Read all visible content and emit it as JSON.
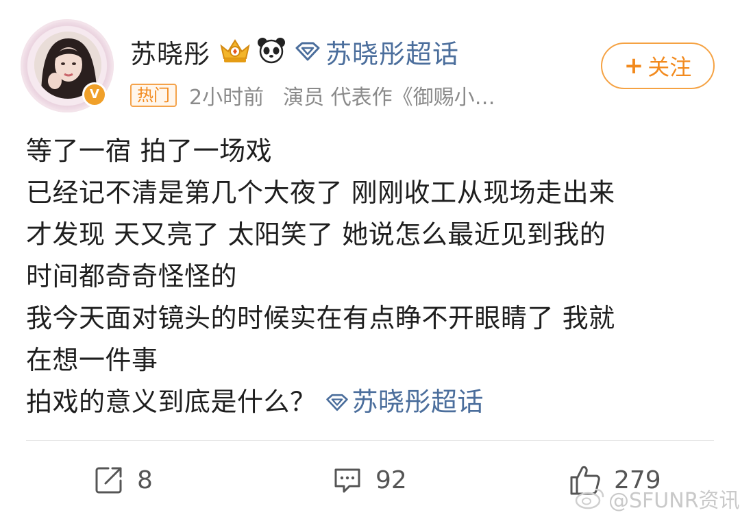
{
  "header": {
    "username": "苏晓彤",
    "topic_link": "苏晓彤超话",
    "hot_badge": "热门",
    "time": "2小时前",
    "bio": "演员 代表作《御赐小…",
    "follow_label": "关注",
    "follow_plus": "+",
    "avatar_badge": "V"
  },
  "content": {
    "lines": [
      "等了一宿 拍了一场戏",
      "已经记不清是第几个大夜了 刚刚收工从现场走出来",
      "才发现 天又亮了 太阳笑了 她说怎么最近见到我的",
      "时间都奇奇怪怪的",
      "我今天面对镜头的时候实在有点睁不开眼睛了 我就",
      "在想一件事",
      "拍戏的意义到底是什么？"
    ],
    "inline_topic": "苏晓彤超话"
  },
  "actions": {
    "repost_count": "8",
    "comment_count": "92",
    "like_count": "279"
  },
  "watermark": "@SFUNR资讯",
  "colors": {
    "accent_orange": "#f28a1e",
    "link_blue": "#4b6e9c",
    "meta_gray": "#8a8a8a",
    "verified_badge": "#f0a02a"
  },
  "icons": [
    "crown-icon",
    "panda-icon",
    "diamond-topic-icon",
    "repost-icon",
    "comment-icon",
    "like-icon",
    "weibo-icon",
    "verified-icon"
  ]
}
